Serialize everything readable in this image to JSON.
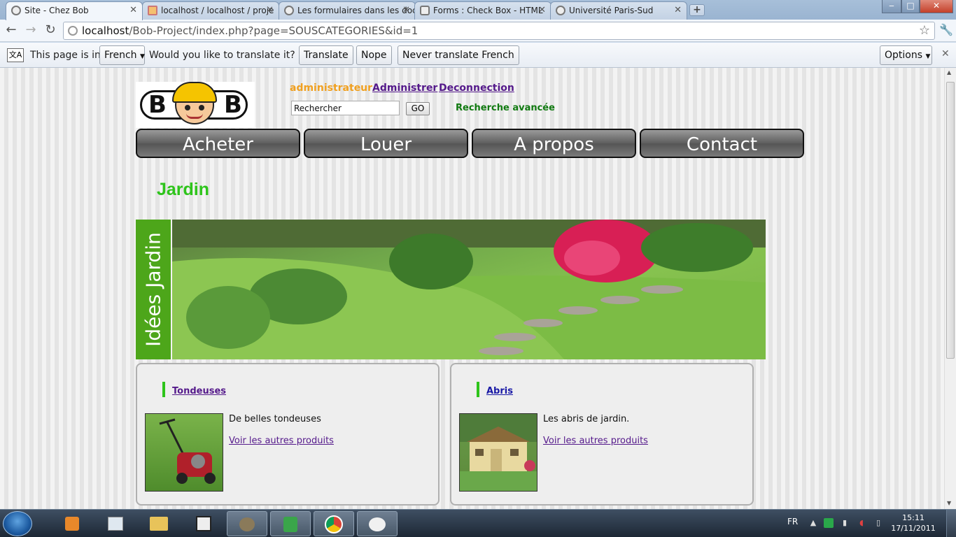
{
  "browser": {
    "tabs": [
      {
        "title": "Site - Chez Bob",
        "active": true
      },
      {
        "title": "localhost / localhost / proje",
        "active": false
      },
      {
        "title": "Les formulaires dans les doc",
        "active": false
      },
      {
        "title": "Forms : Check Box - HTML",
        "active": false
      },
      {
        "title": "Université Paris-Sud",
        "active": false
      }
    ],
    "new_tab": "+",
    "url_host": "localhost",
    "url_path": "/Bob-Project/index.php?page=SOUSCATEGORIES&id=1",
    "window_buttons": {
      "minimize": "‒",
      "maximize": "□",
      "close": "✕"
    }
  },
  "translate_bar": {
    "prefix": "This page is in",
    "language": "French",
    "question": "Would you like to translate it?",
    "translate": "Translate",
    "nope": "Nope",
    "never": "Never translate French",
    "options": "Options"
  },
  "site": {
    "user": "administrateur",
    "admin_link": "Administrer",
    "logout_link": "Deconnection",
    "search_value": "Rechercher",
    "go": "GO",
    "advanced_search": "Recherche avancée",
    "menu": [
      "Acheter",
      "Louer",
      "A propos",
      "Contact"
    ],
    "category_title": "Jardin",
    "banner_text": "Idées Jardin",
    "cards": [
      {
        "title": "Tondeuses",
        "description": "De belles tondeuses",
        "link": "Voir les autres produits"
      },
      {
        "title": "Abris",
        "description": "Les abris de jardin.",
        "link": "Voir les autres produits"
      }
    ]
  },
  "taskbar": {
    "language": "FR",
    "time": "15:11",
    "date": "17/11/2011"
  },
  "colors": {
    "accent_green": "#2ec41b",
    "user_orange": "#f0a020",
    "link_purple": "#551a8b",
    "banner_green": "#4da61a"
  }
}
